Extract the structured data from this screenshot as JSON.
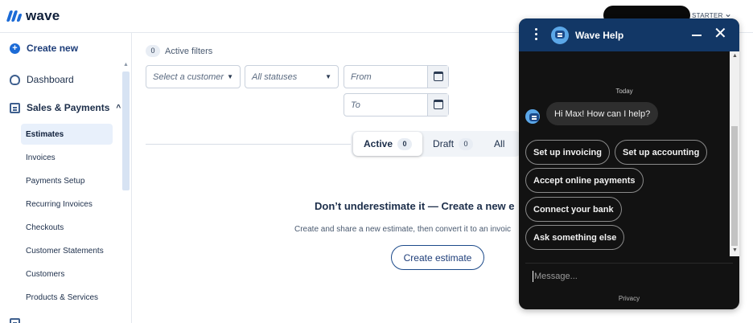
{
  "app": {
    "brand": "wave",
    "plan_badge": "STARTER"
  },
  "sidebar": {
    "create_new": "Create new",
    "dashboard": "Dashboard",
    "section": "Sales & Payments",
    "items": [
      {
        "label": "Estimates",
        "active": true
      },
      {
        "label": "Invoices"
      },
      {
        "label": "Payments Setup"
      },
      {
        "label": "Recurring Invoices"
      },
      {
        "label": "Checkouts"
      },
      {
        "label": "Customer Statements"
      },
      {
        "label": "Customers"
      },
      {
        "label": "Products & Services"
      }
    ]
  },
  "filters": {
    "active_count": "0",
    "active_label": "Active filters",
    "customer_placeholder": "Select a customer",
    "status_placeholder": "All statuses",
    "from_placeholder": "From",
    "to_placeholder": "To"
  },
  "tabs": [
    {
      "label": "Active",
      "count": "0",
      "active": true
    },
    {
      "label": "Draft",
      "count": "0"
    },
    {
      "label": "All"
    }
  ],
  "empty_state": {
    "title": "Don’t underestimate it — Create a new e",
    "subtitle": "Create and share a new estimate, then convert it to an invoic",
    "button": "Create estimate"
  },
  "help": {
    "title": "Wave Help",
    "day_label": "Today",
    "greeting": "Hi Max! How can I help?",
    "quick_replies": [
      "Set up invoicing",
      "Set up accounting",
      "Accept online payments",
      "Connect your bank",
      "Ask something else"
    ],
    "message_placeholder": "Message...",
    "footer": "Privacy"
  },
  "colors": {
    "brand_blue": "#1c6bd6",
    "help_header": "#123766",
    "help_panel": "#121212",
    "active_nav": "#e8f0fb"
  }
}
